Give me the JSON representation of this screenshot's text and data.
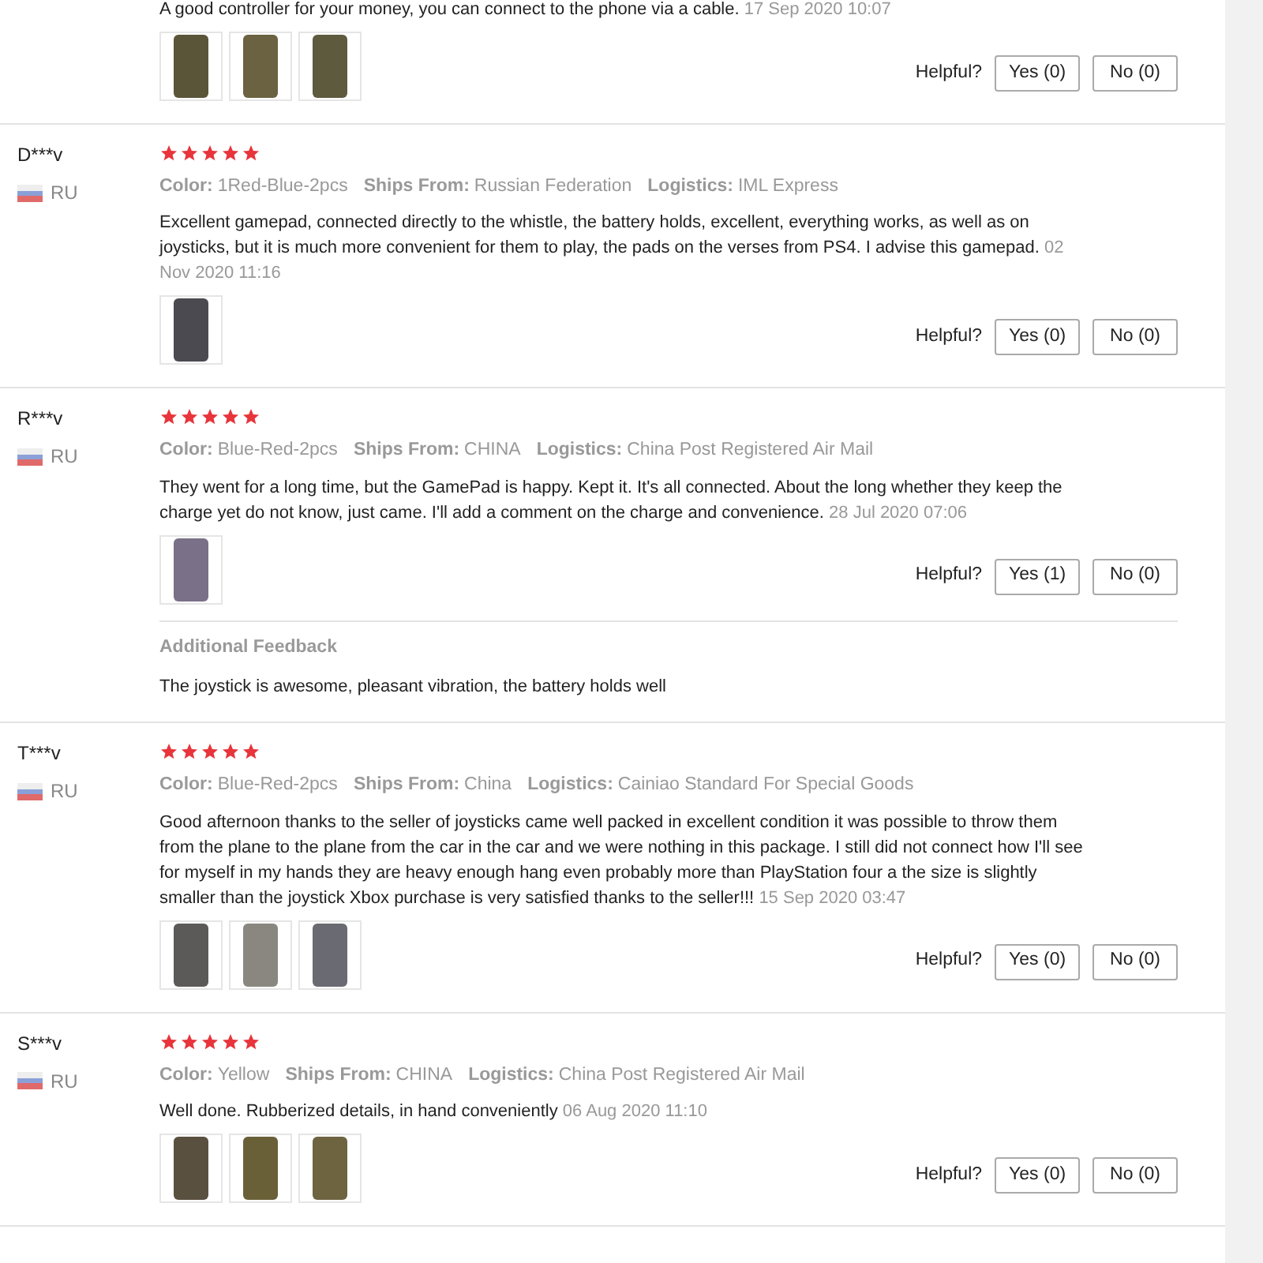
{
  "reviews": [
    {
      "text": "A good controller for your money, you can connect to the phone via a cable.",
      "date": "17 Sep 2020 10:07",
      "photos": [
        {
          "kind": "photo",
          "color": "#5a5438"
        },
        {
          "kind": "photo",
          "color": "#6a6240"
        },
        {
          "kind": "photo",
          "color": "#5e5a3e"
        }
      ],
      "helpful": {
        "label": "Helpful?",
        "yes": "Yes (0)",
        "no": "No (0)"
      }
    },
    {
      "user": "D***v",
      "country": "RU",
      "stars": 5,
      "attributes": [
        {
          "label": "Color:",
          "value": "1Red-Blue-2pcs"
        },
        {
          "label": "Ships From:",
          "value": "Russian Federation"
        },
        {
          "label": "Logistics:",
          "value": "IML Express"
        }
      ],
      "text": "Excellent gamepad, connected directly to the whistle, the battery holds, excellent, everything works, as well as on joysticks, but it is much more convenient for them to play, the pads on the verses from PS4. I advise this gamepad.",
      "date": "02 Nov 2020 11:16",
      "photos": [
        {
          "kind": "photo",
          "color": "#4a4a50"
        }
      ],
      "helpful": {
        "label": "Helpful?",
        "yes": "Yes (0)",
        "no": "No (0)"
      }
    },
    {
      "user": "R***v",
      "country": "RU",
      "stars": 5,
      "attributes": [
        {
          "label": "Color:",
          "value": "Blue-Red-2pcs"
        },
        {
          "label": "Ships From:",
          "value": "CHINA"
        },
        {
          "label": "Logistics:",
          "value": "China Post Registered Air Mail"
        }
      ],
      "text": "They went for a long time, but the GamePad is happy. Kept it. It's all connected. About the long whether they keep the charge yet do not know, just came. I'll add a comment on the charge and convenience.",
      "date": "28 Jul 2020 07:06",
      "photos": [
        {
          "kind": "photo",
          "color": "#7a7088"
        }
      ],
      "helpful": {
        "label": "Helpful?",
        "yes": "Yes (1)",
        "no": "No (0)"
      },
      "additional": {
        "title": "Additional Feedback",
        "text": "The joystick is awesome, pleasant vibration, the battery holds well"
      }
    },
    {
      "user": "T***v",
      "country": "RU",
      "stars": 5,
      "attributes": [
        {
          "label": "Color:",
          "value": "Blue-Red-2pcs"
        },
        {
          "label": "Ships From:",
          "value": "China"
        },
        {
          "label": "Logistics:",
          "value": "Cainiao Standard For Special Goods"
        }
      ],
      "text": "Good afternoon thanks to the seller of joysticks came well packed in excellent condition it was possible to throw them from the plane to the plane from the car in the car and we were nothing in this package. I still did not connect how I'll see for myself in my hands they are heavy enough hang even probably more than PlayStation four a the size is slightly smaller than the joystick Xbox purchase is very satisfied thanks to the seller!!!",
      "date": "15 Sep 2020 03:47",
      "photos": [
        {
          "kind": "photo",
          "color": "#5c5a58"
        },
        {
          "kind": "photo",
          "color": "#8a8780"
        },
        {
          "kind": "photo",
          "color": "#6a6a72"
        }
      ],
      "helpful": {
        "label": "Helpful?",
        "yes": "Yes (0)",
        "no": "No (0)"
      }
    },
    {
      "user": "S***v",
      "country": "RU",
      "stars": 5,
      "attributes": [
        {
          "label": "Color:",
          "value": "Yellow"
        },
        {
          "label": "Ships From:",
          "value": "CHINA"
        },
        {
          "label": "Logistics:",
          "value": "China Post Registered Air Mail"
        }
      ],
      "text": "Well done. Rubberized details, in hand conveniently",
      "date": "06 Aug 2020 11:10",
      "photos": [
        {
          "kind": "photo",
          "color": "#5a5040"
        },
        {
          "kind": "photo",
          "color": "#6a6038"
        },
        {
          "kind": "photo",
          "color": "#6e6440"
        }
      ],
      "helpful": {
        "label": "Helpful?",
        "yes": "Yes (0)",
        "no": "No (0)"
      }
    }
  ]
}
